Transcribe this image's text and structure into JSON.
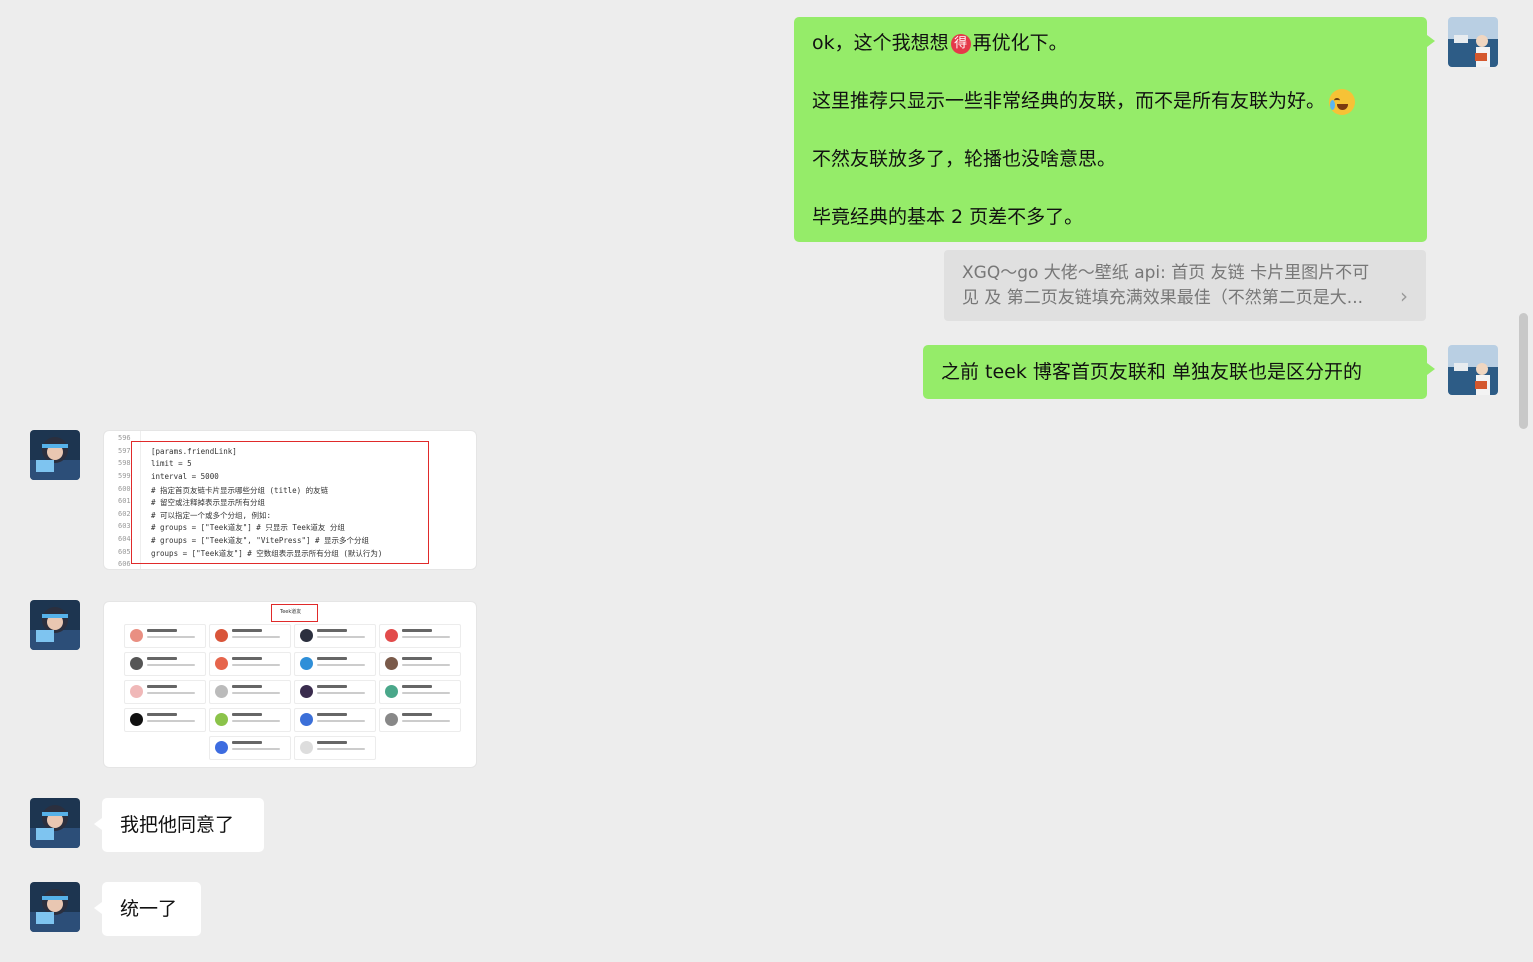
{
  "messages": {
    "msg1": {
      "line1_a": "ok，这个我想想",
      "line1_emoji": "得",
      "line1_b": "再优化下。",
      "line2": "这里推荐只显示一些非常经典的友联，而不是所有友联为好。",
      "line3": "不然友联放多了，轮播也没啥意思。",
      "line4": "毕竟经典的基本 2 页差不多了。"
    },
    "quote": {
      "line1": "XGQ～go 大佬～壁纸 api: 首页 友链 卡片里图片不可",
      "line2": "见 及 第二页友链填充满效果最佳（不然第二页是大..."
    },
    "msg2": "之前 teek 博客首页友联和  单独友联也是区分开的",
    "msg3": "我把他同意了",
    "msg4": "统一了"
  },
  "code_screenshot": {
    "line_numbers": [
      "596",
      "597",
      "598",
      "599",
      "600",
      "601",
      "602",
      "603",
      "604",
      "605",
      "606"
    ],
    "lines": [
      "",
      "[params.friendLink]",
      "  limit = 5",
      "  interval = 5000",
      "  # 指定首页友链卡片显示哪些分组 (title) 的友链",
      "  # 留空或注释掉表示显示所有分组",
      "  # 可以指定一个或多个分组, 例如:",
      "  # groups = [\"Teek道友\"]  # 只显示 Teek道友 分组",
      "  # groups = [\"Teek道友\", \"VitePress\"]  # 显示多个分组",
      "  groups = [\"Teek道友\"]  # 空数组表示显示所有分组 (默认行为)",
      ""
    ]
  },
  "grid_screenshot": {
    "title": "Teek道友"
  },
  "colors": {
    "me_bubble": "#95ec69",
    "other_bubble": "#ffffff",
    "background": "#ededed"
  }
}
